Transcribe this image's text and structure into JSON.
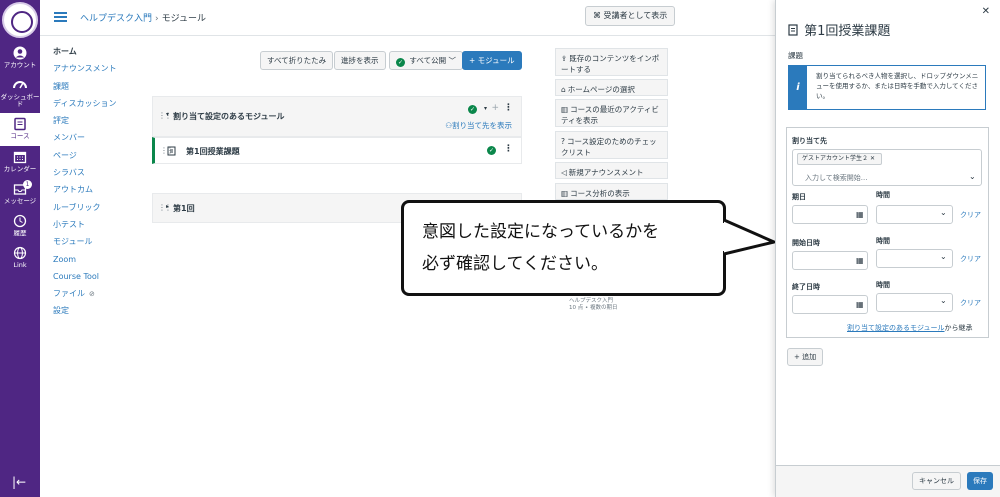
{
  "global_nav": {
    "items": [
      {
        "label": "アカウント",
        "icon": "user-icon"
      },
      {
        "label": "ダッシュボード",
        "icon": "dashboard-icon"
      },
      {
        "label": "コース",
        "icon": "book-icon"
      },
      {
        "label": "カレンダー",
        "icon": "calendar-icon"
      },
      {
        "label": "メッセージ",
        "icon": "inbox-icon",
        "badge": "1"
      },
      {
        "label": "履歴",
        "icon": "clock-icon"
      },
      {
        "label": "Link",
        "icon": "globe-icon"
      }
    ],
    "collapse_glyph": "|←"
  },
  "header": {
    "breadcrumb_course": "ヘルプデスク入門",
    "breadcrumb_sep": "›",
    "breadcrumb_page": "モジュール",
    "student_view": "受講者として表示"
  },
  "course_nav": [
    "ホーム",
    "アナウンスメント",
    "課題",
    "ディスカッション",
    "評定",
    "メンバー",
    "ページ",
    "シラバス",
    "アウトカム",
    "ルーブリック",
    "小テスト",
    "モジュール",
    "Zoom",
    "Course Tool",
    "ファイル",
    "設定"
  ],
  "toolbar": {
    "collapse_all": "すべて折りたたみ",
    "view_progress": "進捗を表示",
    "publish_all": "すべて公開",
    "add_module": "+ モジュール"
  },
  "modules": {
    "module1_title": "割り当て設定のあるモジュール",
    "module1_assign": "割り当て先を表示",
    "item1": "第1回授業課題",
    "module2_title": "第1回"
  },
  "right_sidebar": [
    "既存のコンテンツをインポートする",
    "ホームページの選択",
    "コースの最近のアクティビティを表示",
    "コース設定のためのチェックリスト",
    "新規アナウンスメント",
    "コース分析の表示"
  ],
  "todo_partial": [
    "ヘルプデスク入門",
    "10 点 • 複数の期日"
  ],
  "callout": {
    "line1": "意図した設定になっているかを",
    "line2": "必ず確認してください。"
  },
  "tray": {
    "close": "✕",
    "title": "第1回授業課題",
    "subtitle": "課題",
    "info_text": "割り当てられるべき人物を選択し、ドロップダウンメニューを使用するか、または日時を手動で入力してください。",
    "assign_to_label": "割り当て先",
    "chip": "ゲストアカウント学生２",
    "search_placeholder": "入力して検索開始...",
    "due_label": "期日",
    "time_label": "時間",
    "available_from_label": "開始日時",
    "until_label": "終了日時",
    "clear_label": "クリア",
    "inherit_link": "割り当て設定のあるモジュール",
    "inherit_suffix": "から継承",
    "add": "追加",
    "cancel": "キャンセル",
    "save": "保存"
  },
  "colors": {
    "brand_purple": "#4f2683",
    "link_blue": "#2b7abc",
    "publish_green": "#0b874b"
  }
}
